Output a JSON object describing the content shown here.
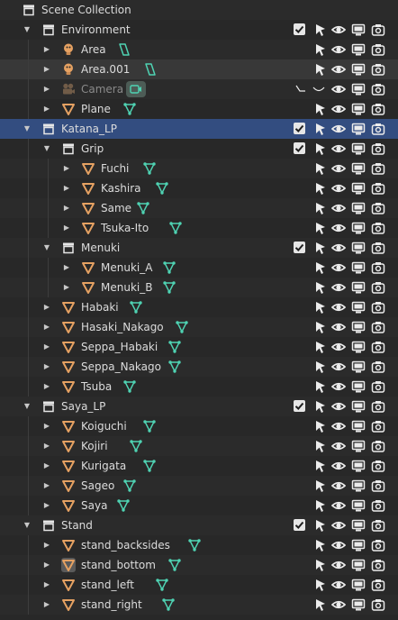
{
  "colors": {
    "panel_bg": "#282828",
    "row_alt": "#2b2b2b",
    "selected_row": "#334d80",
    "object_orange": "#e5a162",
    "mesh_data_teal": "#4fd3b3",
    "light_data_teal": "#4fd3b3"
  },
  "rows": [
    {
      "label": "Scene Collection",
      "type": "scene",
      "depth": 0,
      "arrow": "none"
    },
    {
      "label": "Environment",
      "type": "collection",
      "depth": 1,
      "arrow": "down",
      "checkbox": true
    },
    {
      "label": "Area",
      "type": "light",
      "depth": 2,
      "arrow": "right",
      "data_icon": "light-data-icon"
    },
    {
      "label": "Area.001",
      "type": "light",
      "depth": 2,
      "arrow": "right",
      "data_icon": "light-data-icon",
      "state": "hover"
    },
    {
      "label": "Camera",
      "type": "camera",
      "depth": 2,
      "arrow": "right",
      "data_icon": "camera-data-icon",
      "state": "disabled"
    },
    {
      "label": "Plane",
      "type": "mesh",
      "depth": 2,
      "arrow": "right",
      "data_icon": "mesh-data-icon"
    },
    {
      "label": "Katana_LP",
      "type": "collection",
      "depth": 1,
      "arrow": "down",
      "checkbox": true,
      "state": "selected"
    },
    {
      "label": "Grip",
      "type": "collection",
      "depth": 2,
      "arrow": "down",
      "checkbox": true
    },
    {
      "label": "Fuchi",
      "type": "mesh",
      "depth": 3,
      "arrow": "right",
      "data_icon": "mesh-data-icon"
    },
    {
      "label": "Kashira",
      "type": "mesh",
      "depth": 3,
      "arrow": "right",
      "data_icon": "mesh-data-icon"
    },
    {
      "label": "Same",
      "type": "mesh",
      "depth": 3,
      "arrow": "right",
      "data_icon": "mesh-data-icon"
    },
    {
      "label": "Tsuka-Ito",
      "type": "mesh",
      "depth": 3,
      "arrow": "right",
      "data_icon": "mesh-data-icon"
    },
    {
      "label": "Menuki",
      "type": "collection",
      "depth": 2,
      "arrow": "down",
      "checkbox": true
    },
    {
      "label": "Menuki_A",
      "type": "mesh",
      "depth": 3,
      "arrow": "right",
      "data_icon": "mesh-data-icon"
    },
    {
      "label": "Menuki_B",
      "type": "mesh",
      "depth": 3,
      "arrow": "right",
      "data_icon": "mesh-data-icon"
    },
    {
      "label": "Habaki",
      "type": "mesh",
      "depth": 2,
      "arrow": "right",
      "data_icon": "mesh-data-icon"
    },
    {
      "label": "Hasaki_Nakago",
      "type": "mesh",
      "depth": 2,
      "arrow": "right",
      "data_icon": "mesh-data-icon"
    },
    {
      "label": "Seppa_Habaki",
      "type": "mesh",
      "depth": 2,
      "arrow": "right",
      "data_icon": "mesh-data-icon"
    },
    {
      "label": "Seppa_Nakago",
      "type": "mesh",
      "depth": 2,
      "arrow": "right",
      "data_icon": "mesh-data-icon"
    },
    {
      "label": "Tsuba",
      "type": "mesh",
      "depth": 2,
      "arrow": "right",
      "data_icon": "mesh-data-icon"
    },
    {
      "label": "Saya_LP",
      "type": "collection",
      "depth": 1,
      "arrow": "down",
      "checkbox": true
    },
    {
      "label": "Koiguchi",
      "type": "mesh",
      "depth": 2,
      "arrow": "right",
      "data_icon": "mesh-data-icon"
    },
    {
      "label": "Kojiri",
      "type": "mesh",
      "depth": 2,
      "arrow": "right",
      "data_icon": "mesh-data-icon"
    },
    {
      "label": "Kurigata",
      "type": "mesh",
      "depth": 2,
      "arrow": "right",
      "data_icon": "mesh-data-icon"
    },
    {
      "label": "Sageo",
      "type": "mesh",
      "depth": 2,
      "arrow": "right",
      "data_icon": "mesh-data-icon"
    },
    {
      "label": "Saya",
      "type": "mesh",
      "depth": 2,
      "arrow": "right",
      "data_icon": "mesh-data-icon"
    },
    {
      "label": "Stand",
      "type": "collection",
      "depth": 1,
      "arrow": "down",
      "checkbox": true
    },
    {
      "label": "stand_backsides",
      "type": "mesh",
      "depth": 2,
      "arrow": "right",
      "data_icon": "mesh-data-icon"
    },
    {
      "label": "stand_bottom",
      "type": "mesh",
      "depth": 2,
      "arrow": "right",
      "data_icon": "mesh-data-icon",
      "state": "active-object"
    },
    {
      "label": "stand_left",
      "type": "mesh",
      "depth": 2,
      "arrow": "right",
      "data_icon": "mesh-data-icon"
    },
    {
      "label": "stand_right",
      "type": "mesh",
      "depth": 2,
      "arrow": "right",
      "data_icon": "mesh-data-icon"
    }
  ]
}
